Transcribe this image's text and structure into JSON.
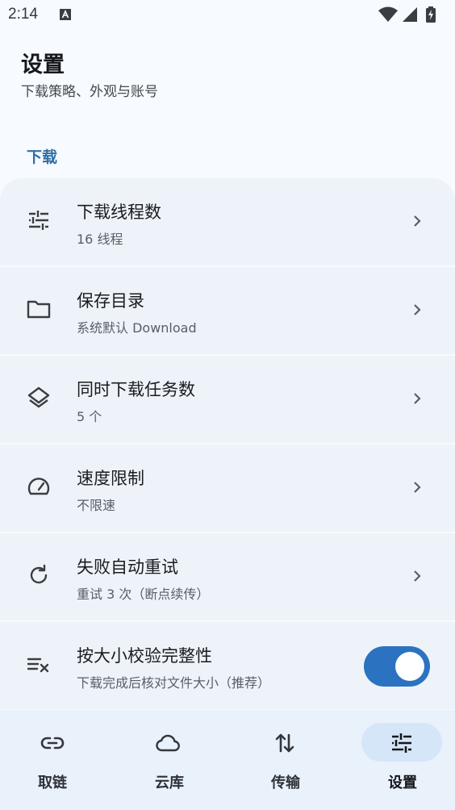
{
  "status_bar": {
    "time": "2:14"
  },
  "header": {
    "title": "设置",
    "subtitle": "下载策略、外观与账号"
  },
  "section": {
    "label": "下载"
  },
  "settings": [
    {
      "icon": "sliders-icon",
      "title": "下载线程数",
      "subtitle": "16 线程"
    },
    {
      "icon": "folder-icon",
      "title": "保存目录",
      "subtitle": "系统默认 Download"
    },
    {
      "icon": "layers-icon",
      "title": "同时下载任务数",
      "subtitle": "5 个"
    },
    {
      "icon": "speedometer-icon",
      "title": "速度限制",
      "subtitle": "不限速"
    },
    {
      "icon": "refresh-icon",
      "title": "失败自动重试",
      "subtitle": "重试 3 次（断点续传）"
    },
    {
      "icon": "list-check-icon",
      "title": "按大小校验完整性",
      "subtitle": "下载完成后核对文件大小（推荐）",
      "toggle_on": true
    }
  ],
  "bottom_nav": [
    {
      "icon": "link-icon",
      "label": "取链"
    },
    {
      "icon": "cloud-icon",
      "label": "云库"
    },
    {
      "icon": "transfer-icon",
      "label": "传输"
    },
    {
      "icon": "sliders-icon",
      "label": "设置",
      "active": true
    }
  ],
  "colors": {
    "accent": "#2b73c0",
    "section": "#2f6fa8",
    "card": "#eef3fa",
    "background": "#f7fafe"
  }
}
